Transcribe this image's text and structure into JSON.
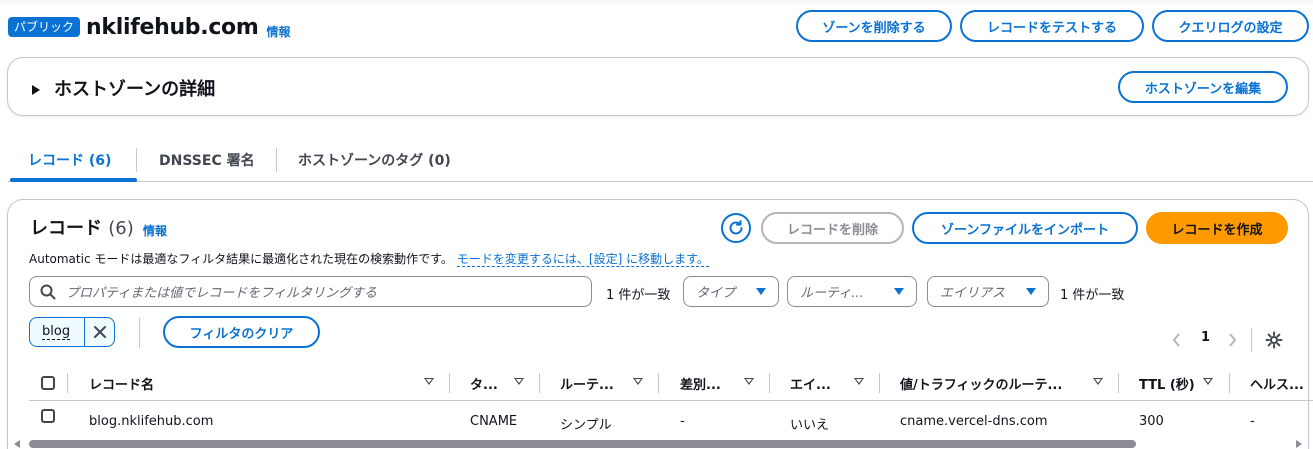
{
  "header": {
    "badge": "パブリック",
    "zone_name": "nklifehub.com",
    "info": "情報",
    "buttons": {
      "delete_zone": "ゾーンを削除する",
      "test_record": "レコードをテストする",
      "query_log": "クエリログの設定"
    }
  },
  "details": {
    "title": "ホストゾーンの詳細",
    "edit_button": "ホストゾーンを編集"
  },
  "tabs": [
    {
      "label": "レコード (6)"
    },
    {
      "label": "DNSSEC 署名"
    },
    {
      "label": "ホストゾーンのタグ (0)"
    }
  ],
  "records": {
    "title": "レコード",
    "count": "(6)",
    "info": "情報",
    "delete_button": "レコードを削除",
    "import_button": "ゾーンファイルをインポート",
    "create_button": "レコードを作成",
    "auto_text": "Automatic モードは最適なフィルタ結果に最適化された現在の検索動作です。",
    "auto_link": "モードを変更するには、[設定] に移動します。",
    "search_placeholder": "プロパティまたは値でレコードをフィルタリングする",
    "match_left": "1 件が一致",
    "match_right": "1 件が一致",
    "filters": {
      "type": "タイプ",
      "routing": "ルーティ...",
      "alias": "エイリアス"
    },
    "token": "blog",
    "clear_filters": "フィルタのクリア",
    "page": "1",
    "columns": [
      "レコード名",
      "タ...",
      "ルーテ...",
      "差別...",
      "エイ...",
      "値/トラフィックのルーテ...",
      "TTL (秒)",
      "ヘルス..."
    ],
    "rows": [
      {
        "name": "blog.nklifehub.com",
        "type": "CNAME",
        "routing": "シンプル",
        "differentiator": "-",
        "alias": "いいえ",
        "value": "cname.vercel-dns.com",
        "ttl": "300",
        "health": "-"
      }
    ]
  },
  "colors": {
    "link": "#0972d3",
    "primary": "#ff9900",
    "border": "#c6c6cd"
  }
}
